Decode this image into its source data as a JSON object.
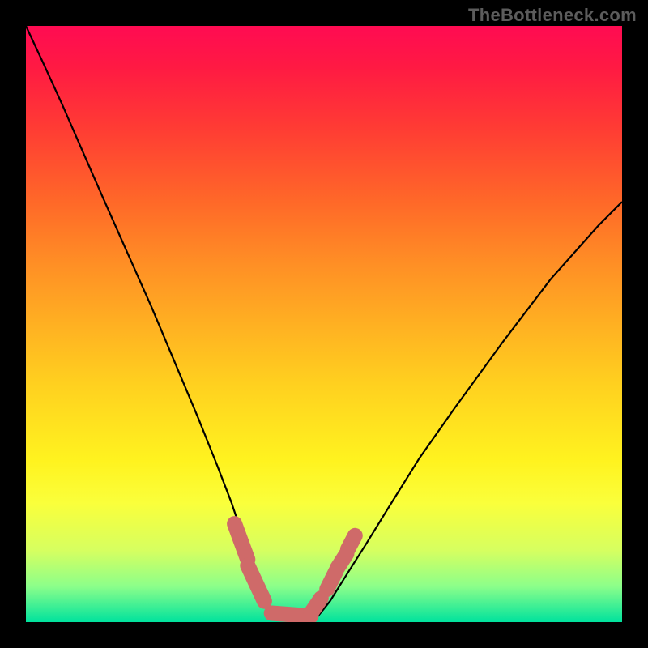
{
  "watermark": {
    "text": "TheBottleneck.com"
  },
  "chart_data": {
    "type": "line",
    "title": "",
    "xlabel": "",
    "ylabel": "",
    "xlim": [
      0,
      1
    ],
    "ylim": [
      0,
      1
    ],
    "series": [
      {
        "name": "bottleneck-curve",
        "x": [
          0.0,
          0.028,
          0.06,
          0.095,
          0.13,
          0.17,
          0.21,
          0.25,
          0.29,
          0.32,
          0.345,
          0.365,
          0.383,
          0.4,
          0.42,
          0.445,
          0.47,
          0.49,
          0.51,
          0.535,
          0.57,
          0.61,
          0.66,
          0.72,
          0.8,
          0.88,
          0.96,
          1.0
        ],
        "values": [
          1.0,
          0.94,
          0.87,
          0.79,
          0.71,
          0.62,
          0.53,
          0.435,
          0.34,
          0.265,
          0.2,
          0.14,
          0.085,
          0.04,
          0.01,
          0.0,
          0.0,
          0.01,
          0.035,
          0.075,
          0.13,
          0.195,
          0.275,
          0.36,
          0.47,
          0.575,
          0.665,
          0.705
        ]
      }
    ],
    "markers": [
      {
        "name": "marker-left",
        "x0": 0.35,
        "y0": 0.165,
        "x1": 0.372,
        "y1": 0.105
      },
      {
        "name": "marker-bottom-l",
        "x0": 0.372,
        "y0": 0.095,
        "x1": 0.4,
        "y1": 0.035
      },
      {
        "name": "marker-floor",
        "x0": 0.412,
        "y0": 0.015,
        "x1": 0.478,
        "y1": 0.01
      },
      {
        "name": "marker-bottom-r",
        "x0": 0.478,
        "y0": 0.015,
        "x1": 0.495,
        "y1": 0.04
      },
      {
        "name": "marker-right-1",
        "x0": 0.505,
        "y0": 0.055,
        "x1": 0.52,
        "y1": 0.085
      },
      {
        "name": "marker-right-2",
        "x0": 0.522,
        "y0": 0.09,
        "x1": 0.538,
        "y1": 0.115
      },
      {
        "name": "marker-right-3",
        "x0": 0.54,
        "y0": 0.122,
        "x1": 0.552,
        "y1": 0.145
      }
    ],
    "colors": {
      "curve": "#000000",
      "marker": "#cf6a69"
    }
  }
}
